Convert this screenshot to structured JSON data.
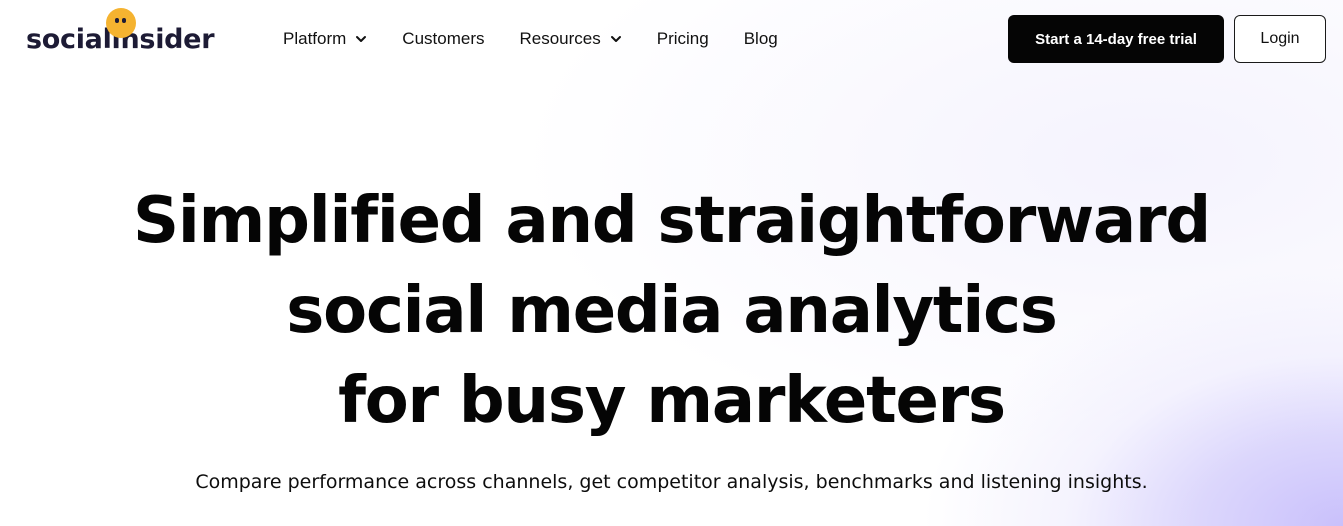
{
  "brand": {
    "logo_text": "socialinsider"
  },
  "nav": {
    "items": [
      {
        "label": "Platform",
        "has_dropdown": true
      },
      {
        "label": "Customers",
        "has_dropdown": false
      },
      {
        "label": "Resources",
        "has_dropdown": true
      },
      {
        "label": "Pricing",
        "has_dropdown": false
      },
      {
        "label": "Blog",
        "has_dropdown": false
      }
    ]
  },
  "header_actions": {
    "trial_label": "Start a 14-day free trial",
    "login_label": "Login"
  },
  "hero": {
    "title_lines": [
      "Simplified and straightforward",
      "social media analytics",
      "for busy marketers"
    ],
    "subtitle": "Compare performance across channels, get competitor analysis, benchmarks and listening insights."
  },
  "colors": {
    "logo_accent": "#f5b330",
    "logo_text": "#1d1b35",
    "primary_button": "#050505",
    "background_accent": "#c9c0fb"
  }
}
